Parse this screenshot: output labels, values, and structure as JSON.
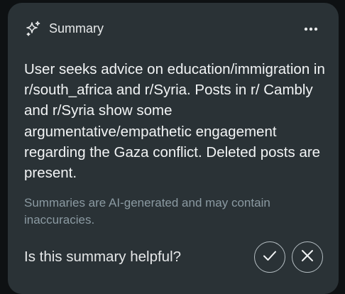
{
  "header": {
    "icon": "sparkle-icon",
    "title": "Summary",
    "more_icon": "more-horizontal-icon"
  },
  "summary": {
    "text": "User seeks advice on education/immigration in r/south_africa and r/Syria. Posts in r/ Cambly and r/Syria show some argumentative/empathetic engagement regarding the Gaza conflict. Deleted posts are present."
  },
  "disclaimer": "Summaries are AI-generated and may contain inaccuracies.",
  "feedback": {
    "question": "Is this summary helpful?",
    "yes_icon": "checkmark-icon",
    "no_icon": "close-icon"
  },
  "colors": {
    "card_bg": "#2a3236",
    "text_primary": "#f2f4f5",
    "text_muted": "#8b9aa2"
  }
}
